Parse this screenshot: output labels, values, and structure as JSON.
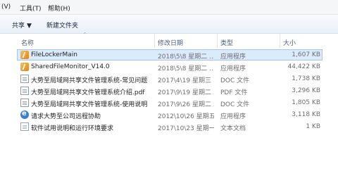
{
  "menu": {
    "view": "(V)",
    "tools": "工具(T)",
    "help": "帮助(H)"
  },
  "toolbar": {
    "share": "共享",
    "share_caret": "▼",
    "new_folder": "新建文件夹"
  },
  "columns": {
    "name": "名称",
    "date": "修改日期",
    "type": "类型",
    "size": "大小"
  },
  "files": [
    {
      "name": "FileLockerMain",
      "date": "2018\\5\\8 星期二 ...",
      "type": "应用程序",
      "size": "1,607 KB",
      "icon": "app-icon"
    },
    {
      "name": "SharedFileMonitor_V14.0",
      "date": "2018\\5\\8 星期二 ...",
      "type": "应用程序",
      "size": "44,422 KB",
      "icon": "app-icon"
    },
    {
      "name": "大势至局域网共享文件管理系统-常见问题",
      "date": "2017\\4\\19 星期三 ...",
      "type": "DOC 文件",
      "size": "1,738 KB",
      "icon": "doc-icon"
    },
    {
      "name": "大势至局域网共享文件管理系统介绍.pdf",
      "date": "2017\\9\\19 星期二 ...",
      "type": "PDF 文件",
      "size": "3,296 KB",
      "icon": "doc-icon"
    },
    {
      "name": "大势至局域网共享文件管理系统-使用说明",
      "date": "2017\\9\\26 星期二 ...",
      "type": "DOC 文件",
      "size": "1,805 KB",
      "icon": "doc-icon"
    },
    {
      "name": "请求大势至公司远程协助",
      "date": "2012\\10\\26 星期五 ...",
      "type": "应用程序",
      "size": "3,118 KB",
      "icon": "remote-app-icon"
    },
    {
      "name": "软件试用说明和运行环境要求",
      "date": "2017\\10\\23 星期一 ...",
      "type": "文本文档",
      "size": "1 KB",
      "icon": "text-file-icon"
    }
  ],
  "selection": {
    "row": 0,
    "color": "#dcebfc"
  }
}
